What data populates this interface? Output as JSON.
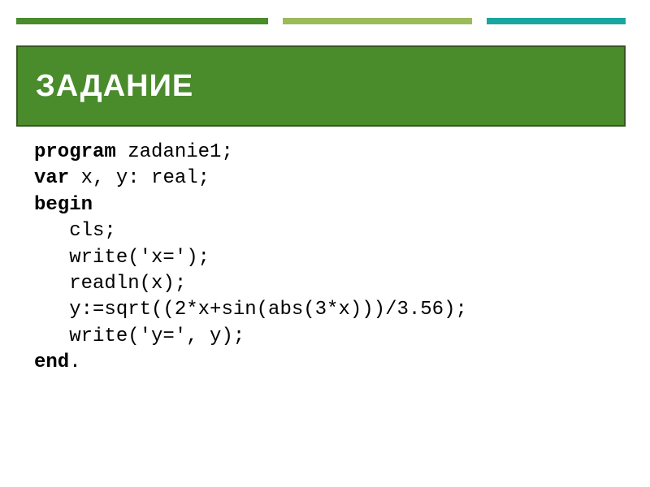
{
  "title": "ЗАДАНИЕ",
  "code": {
    "kw_program": "program",
    "prog_name": " zadanie1;",
    "kw_var": "var",
    "var_decl": " x, y: real;",
    "kw_begin": "begin",
    "line_cls": "   cls;",
    "line_write1": "   write('x=');",
    "line_readln": "   readln(x);",
    "line_assign": "   y:=sqrt((2*x+sin(abs(3*x)))/3.56);",
    "line_write2": "   write('y=', y);",
    "kw_end": "end",
    "end_dot": "."
  }
}
